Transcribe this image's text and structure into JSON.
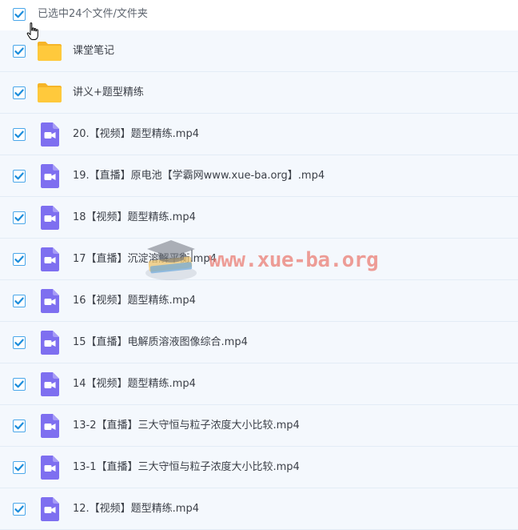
{
  "header": {
    "title": "已选中24个文件/文件夹"
  },
  "items": [
    {
      "name": "课堂笔记",
      "type": "folder"
    },
    {
      "name": "讲义+题型精练",
      "type": "folder"
    },
    {
      "name": "20.【视频】题型精练.mp4",
      "type": "video"
    },
    {
      "name": "19.【直播】原电池【学霸网www.xue-ba.org】.mp4",
      "type": "video"
    },
    {
      "name": "18【视频】题型精练.mp4",
      "type": "video"
    },
    {
      "name": "17【直播】沉淀溶解平衡.mp4",
      "type": "video"
    },
    {
      "name": "16【视频】题型精练.mp4",
      "type": "video"
    },
    {
      "name": "15【直播】电解质溶液图像综合.mp4",
      "type": "video"
    },
    {
      "name": "14【视频】题型精练.mp4",
      "type": "video"
    },
    {
      "name": "13-2【直播】三大守恒与粒子浓度大小比较.mp4",
      "type": "video"
    },
    {
      "name": "13-1【直播】三大守恒与粒子浓度大小比较.mp4",
      "type": "video"
    },
    {
      "name": "12.【视频】题型精练.mp4",
      "type": "video"
    }
  ],
  "watermark": {
    "text": "www.xue-ba.org"
  },
  "colors": {
    "checkbox_accent": "#1c8ddb",
    "folder": "#ffc93c",
    "video_icon": "#7e6ff0",
    "row_background": "#f4f8fd"
  },
  "icons": {
    "checkbox": "checkmark-icon",
    "folder": "folder-icon",
    "video": "video-file-icon",
    "cursor": "hand-cursor-icon"
  }
}
